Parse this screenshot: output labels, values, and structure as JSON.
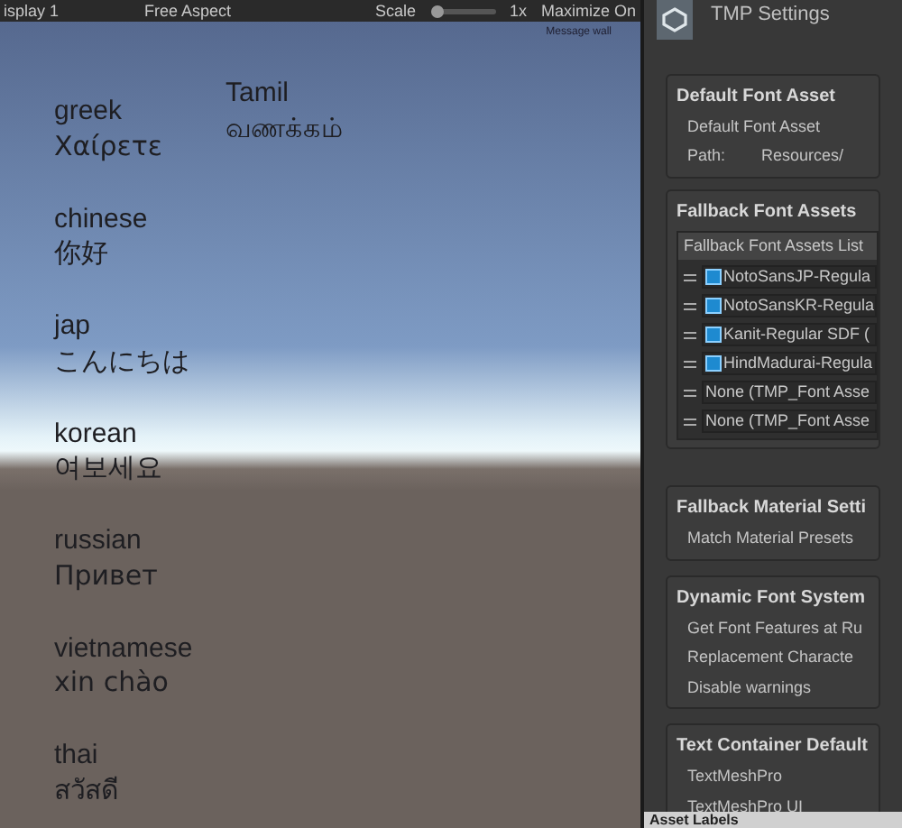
{
  "toolbar": {
    "display": "isplay 1",
    "aspect": "Free Aspect",
    "scale_label": "Scale",
    "scale_slider": {
      "level": 0
    },
    "scale_value": "1x",
    "maximize": "Maximize On"
  },
  "game_view": {
    "corner_text": "Message wall",
    "side_greeting": {
      "language": "Tamil",
      "greeting": "வணக்கம்"
    },
    "greetings": [
      {
        "language": "greek",
        "greeting": "Χαίρετε"
      },
      {
        "language": "chinese",
        "greeting": "你好"
      },
      {
        "language": "jap",
        "greeting": "こんにちは"
      },
      {
        "language": "korean",
        "greeting": "여보세요"
      },
      {
        "language": "russian",
        "greeting": "Привет"
      },
      {
        "language": "vietnamese",
        "greeting": "xin chào"
      },
      {
        "language": "thai",
        "greeting": "สวัสดี"
      }
    ]
  },
  "inspector": {
    "title": "TMP Settings",
    "default_font": {
      "heading": "Default Font Asset",
      "label": "Default Font Asset",
      "path_label": "Path:",
      "path_value": "Resources/"
    },
    "fallback": {
      "heading": "Fallback Font Assets",
      "list_header": "Fallback Font Assets List",
      "items": [
        {
          "kind": "asset",
          "name": "NotoSansJP-Regula"
        },
        {
          "kind": "asset",
          "name": "NotoSansKR-Regula"
        },
        {
          "kind": "asset",
          "name": "Kanit-Regular SDF ("
        },
        {
          "kind": "asset",
          "name": "HindMadurai-Regula"
        },
        {
          "kind": "none",
          "name": "None (TMP_Font Asse"
        },
        {
          "kind": "none",
          "name": "None (TMP_Font Asse"
        }
      ]
    },
    "sections": [
      {
        "heading": "Fallback Material Setti",
        "rows": [
          "Match Material Presets"
        ]
      },
      {
        "heading": "Dynamic Font System",
        "rows": [
          "Get Font Features at Ru",
          "Replacement Characte",
          "Disable warnings"
        ]
      },
      {
        "heading": "Text Container Default",
        "rows": [
          "TextMeshPro",
          "TextMeshPro UI"
        ]
      }
    ],
    "footer": "Asset Labels"
  }
}
